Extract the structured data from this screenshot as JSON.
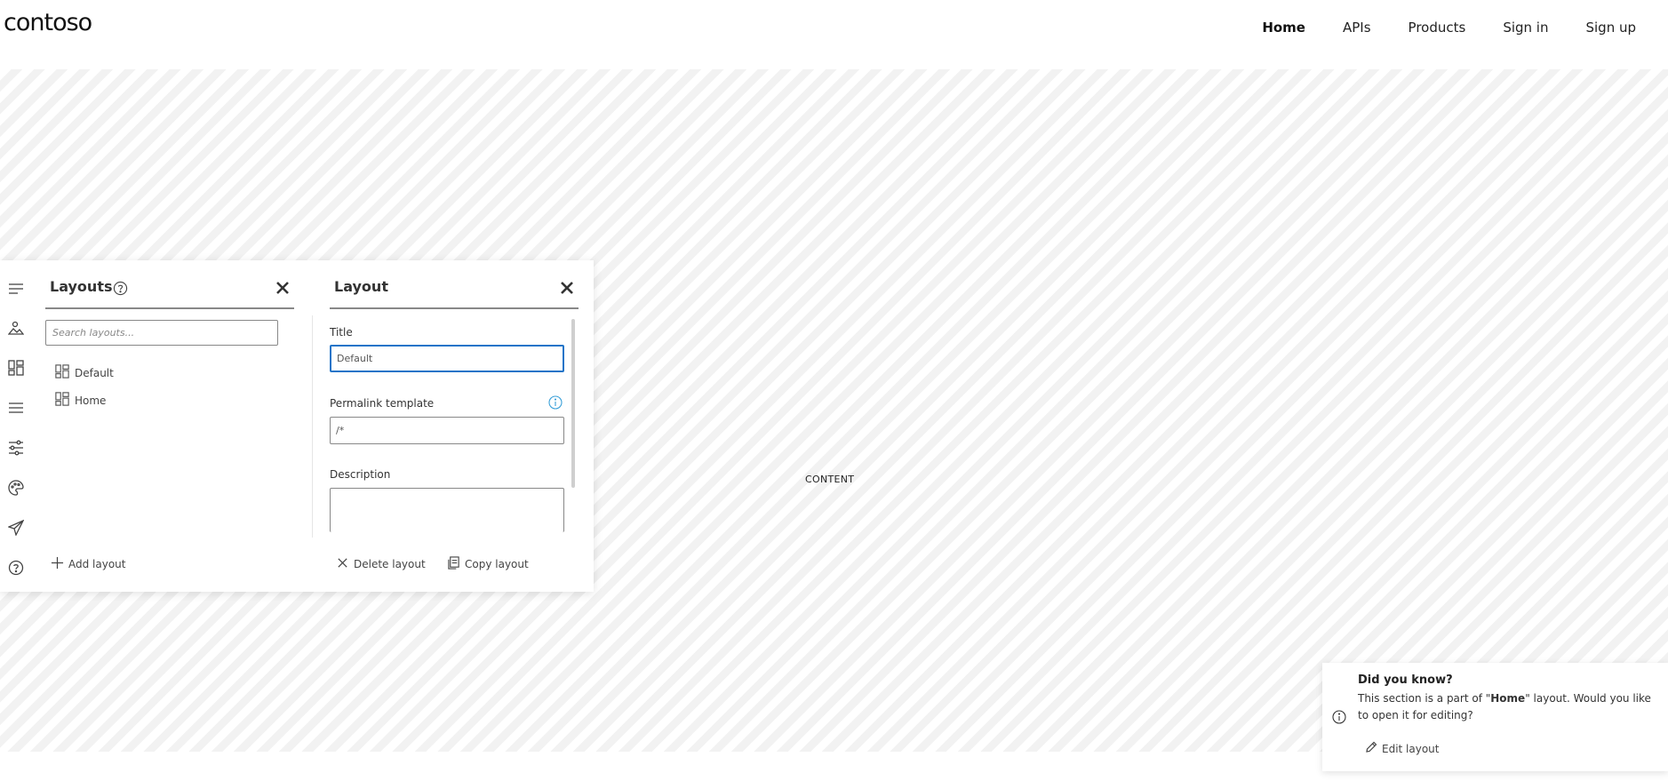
{
  "header": {
    "logo": "contoso",
    "nav": [
      {
        "label": "Home",
        "active": true
      },
      {
        "label": "APIs"
      },
      {
        "label": "Products"
      },
      {
        "label": "Sign in"
      },
      {
        "label": "Sign up"
      }
    ]
  },
  "stage": {
    "content_label": "CONTENT"
  },
  "rail": {
    "icons": [
      "menu-icon",
      "media-icon",
      "layouts-icon",
      "navigation-icon",
      "settings-icon",
      "styles-icon",
      "publish-icon",
      "help-icon"
    ]
  },
  "layouts_panel": {
    "title": "Layouts",
    "search_placeholder": "Search layouts...",
    "items": [
      {
        "label": "Default"
      },
      {
        "label": "Home"
      }
    ],
    "add_label": "Add layout"
  },
  "layout_panel": {
    "title": "Layout",
    "title_label": "Title",
    "title_value": "Default",
    "permalink_label": "Permalink template",
    "permalink_value": "/*",
    "description_label": "Description",
    "description_value": "",
    "delete_label": "Delete layout",
    "copy_label": "Copy layout"
  },
  "toast": {
    "title": "Did you know?",
    "body_prefix": "This section is a part of \"",
    "body_bold": "Home",
    "body_suffix": "\" layout. Would you like to open it for editing?",
    "action": "Edit layout"
  },
  "colors": {
    "focus": "#1e74c8",
    "info": "#3aa0d8"
  }
}
